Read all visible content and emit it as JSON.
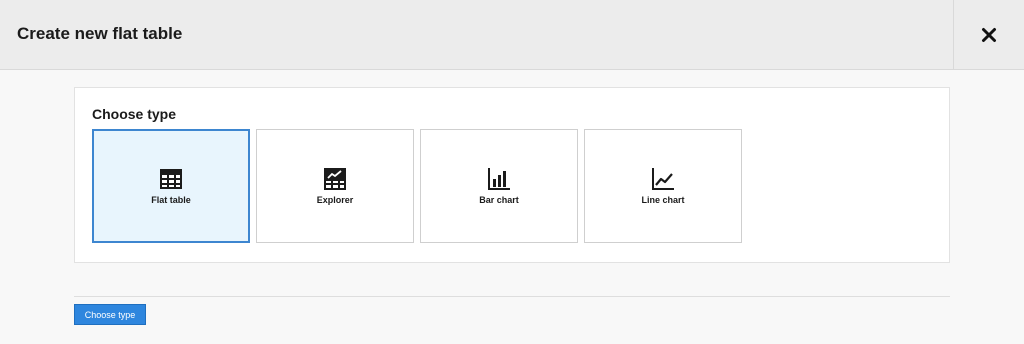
{
  "dialog": {
    "title": "Create new flat table",
    "close_icon": "close-icon"
  },
  "panel": {
    "label": "Choose type",
    "types": [
      {
        "label": "Flat table",
        "icon": "table-icon",
        "selected": true
      },
      {
        "label": "Explorer",
        "icon": "explorer-icon",
        "selected": false
      },
      {
        "label": "Bar chart",
        "icon": "bar-chart-icon",
        "selected": false
      },
      {
        "label": "Line chart",
        "icon": "line-chart-icon",
        "selected": false
      }
    ]
  },
  "footer": {
    "button_label": "Choose type"
  },
  "colors": {
    "accent": "#2e86de",
    "selected_bg": "#e8f5fd",
    "selected_border": "#3d86d0"
  }
}
